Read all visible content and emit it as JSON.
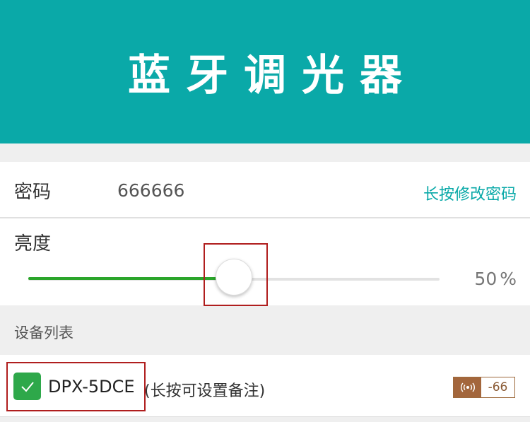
{
  "header": {
    "title": "蓝牙调光器"
  },
  "password_row": {
    "label": "密码",
    "value": "666666",
    "change_link": "长按修改密码"
  },
  "brightness_row": {
    "label": "亮度",
    "value": 50,
    "unit": "%"
  },
  "device_list": {
    "title": "设备列表",
    "devices": [
      {
        "name": "DPX-5DCE",
        "hint": "(长按可设置备注)",
        "checked": true,
        "rssi": "-66",
        "signal_icon": "signal-broadcast-icon"
      }
    ]
  },
  "colors": {
    "header_bg": "#0aa9a8",
    "accent": "#0aa9a8",
    "slider_fill": "#2aa52a",
    "checkbox": "#2ea84a",
    "signal_badge": "#a3663c",
    "highlight_box": "#b01e1e"
  }
}
